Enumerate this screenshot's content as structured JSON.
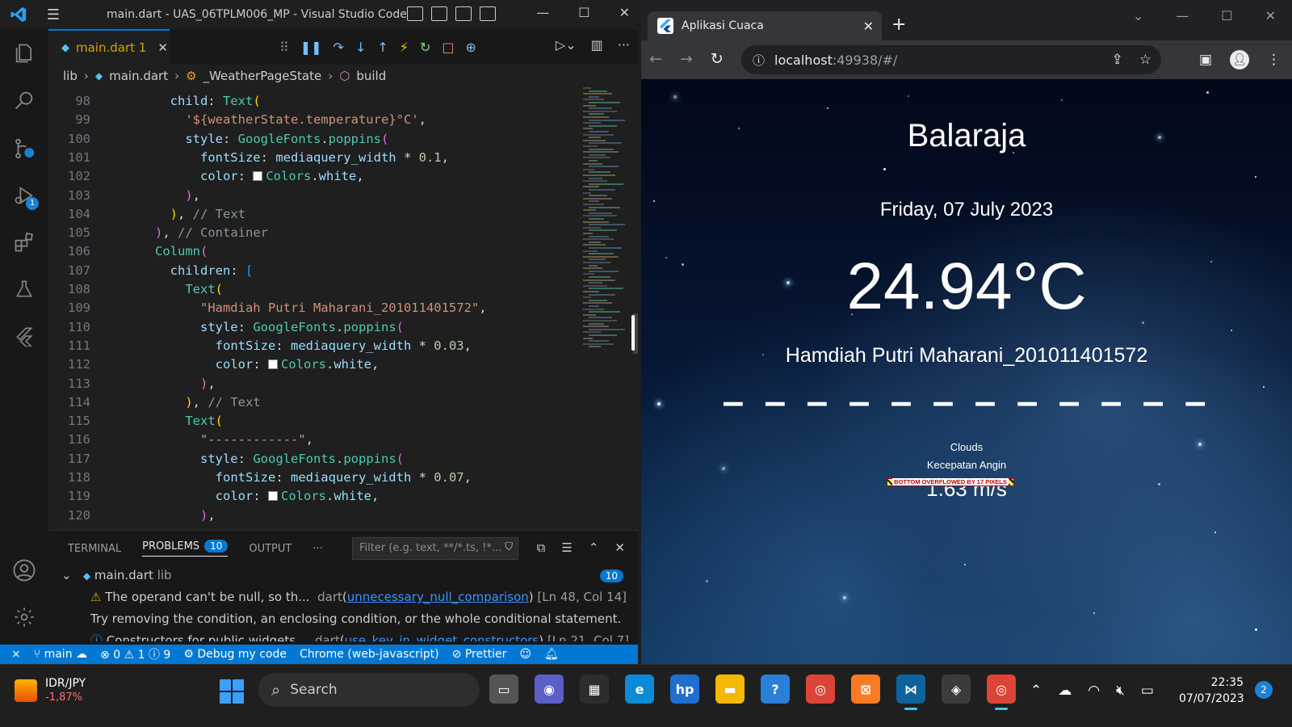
{
  "vscode": {
    "title": "main.dart - UAS_06TPLM006_MP - Visual Studio Code",
    "tab": {
      "label": "main.dart 1",
      "close": "✕"
    },
    "breadcrumb": {
      "folder": "lib",
      "file": "main.dart",
      "class": "_WeatherPageState",
      "method": "build"
    },
    "activity_badges": {
      "run_debug": "1"
    },
    "code_lines": [
      {
        "n": "98",
        "indent": "        ",
        "parts": [
          [
            "prop",
            "child"
          ],
          [
            "plain",
            ": "
          ],
          [
            "func",
            "Text"
          ],
          [
            "br1",
            "("
          ]
        ]
      },
      {
        "n": "99",
        "indent": "          ",
        "parts": [
          [
            "str",
            "'${weatherState.temperature}°C'"
          ],
          [
            "plain",
            ","
          ]
        ]
      },
      {
        "n": "100",
        "indent": "          ",
        "parts": [
          [
            "prop",
            "style"
          ],
          [
            "plain",
            ": "
          ],
          [
            "func",
            "GoogleFonts"
          ],
          [
            "plain",
            "."
          ],
          [
            "func",
            "poppins"
          ],
          [
            "br2",
            "("
          ]
        ]
      },
      {
        "n": "101",
        "indent": "            ",
        "parts": [
          [
            "prop",
            "fontSize"
          ],
          [
            "plain",
            ": "
          ],
          [
            "prop",
            "mediaquery_width"
          ],
          [
            "plain",
            " * "
          ],
          [
            "num",
            "0.1"
          ],
          [
            "plain",
            ","
          ]
        ]
      },
      {
        "n": "102",
        "indent": "            ",
        "parts": [
          [
            "prop",
            "color"
          ],
          [
            "plain",
            ": "
          ],
          [
            "box",
            ""
          ],
          [
            "func",
            "Colors"
          ],
          [
            "plain",
            "."
          ],
          [
            "prop",
            "white"
          ],
          [
            "plain",
            ","
          ]
        ]
      },
      {
        "n": "103",
        "indent": "          ",
        "parts": [
          [
            "br2",
            ")"
          ],
          [
            "plain",
            ","
          ]
        ]
      },
      {
        "n": "104",
        "indent": "        ",
        "parts": [
          [
            "br1",
            ")"
          ],
          [
            "plain",
            ", "
          ],
          [
            "cmt",
            "// Text"
          ]
        ]
      },
      {
        "n": "105",
        "indent": "      ",
        "parts": [
          [
            "br2",
            ")"
          ],
          [
            "plain",
            ", "
          ],
          [
            "cmt",
            "// Container"
          ]
        ]
      },
      {
        "n": "106",
        "indent": "      ",
        "parts": [
          [
            "func",
            "Column"
          ],
          [
            "br2",
            "("
          ]
        ]
      },
      {
        "n": "107",
        "indent": "        ",
        "parts": [
          [
            "prop",
            "children"
          ],
          [
            "plain",
            ": "
          ],
          [
            "br3",
            "["
          ]
        ]
      },
      {
        "n": "108",
        "indent": "          ",
        "parts": [
          [
            "func",
            "Text"
          ],
          [
            "br1",
            "("
          ]
        ]
      },
      {
        "n": "109",
        "indent": "            ",
        "parts": [
          [
            "str",
            "\"Hamdiah Putri Maharani_201011401572\""
          ],
          [
            "plain",
            ","
          ]
        ]
      },
      {
        "n": "110",
        "indent": "            ",
        "parts": [
          [
            "prop",
            "style"
          ],
          [
            "plain",
            ": "
          ],
          [
            "func",
            "GoogleFonts"
          ],
          [
            "plain",
            "."
          ],
          [
            "func",
            "poppins"
          ],
          [
            "br2",
            "("
          ]
        ]
      },
      {
        "n": "111",
        "indent": "              ",
        "parts": [
          [
            "prop",
            "fontSize"
          ],
          [
            "plain",
            ": "
          ],
          [
            "prop",
            "mediaquery_width"
          ],
          [
            "plain",
            " * "
          ],
          [
            "num",
            "0.03"
          ],
          [
            "plain",
            ","
          ]
        ]
      },
      {
        "n": "112",
        "indent": "              ",
        "parts": [
          [
            "prop",
            "color"
          ],
          [
            "plain",
            ": "
          ],
          [
            "box",
            ""
          ],
          [
            "func",
            "Colors"
          ],
          [
            "plain",
            "."
          ],
          [
            "prop",
            "white"
          ],
          [
            "plain",
            ","
          ]
        ]
      },
      {
        "n": "113",
        "indent": "            ",
        "parts": [
          [
            "br2",
            ")"
          ],
          [
            "plain",
            ","
          ]
        ]
      },
      {
        "n": "114",
        "indent": "          ",
        "parts": [
          [
            "br1",
            ")"
          ],
          [
            "plain",
            ", "
          ],
          [
            "cmt",
            "// Text"
          ]
        ]
      },
      {
        "n": "115",
        "indent": "          ",
        "parts": [
          [
            "func",
            "Text"
          ],
          [
            "br1",
            "("
          ]
        ]
      },
      {
        "n": "116",
        "indent": "            ",
        "parts": [
          [
            "str",
            "\"------------\""
          ],
          [
            "plain",
            ","
          ]
        ]
      },
      {
        "n": "117",
        "indent": "            ",
        "parts": [
          [
            "prop",
            "style"
          ],
          [
            "plain",
            ": "
          ],
          [
            "func",
            "GoogleFonts"
          ],
          [
            "plain",
            "."
          ],
          [
            "func",
            "poppins"
          ],
          [
            "br2",
            "("
          ]
        ]
      },
      {
        "n": "118",
        "indent": "              ",
        "parts": [
          [
            "prop",
            "fontSize"
          ],
          [
            "plain",
            ": "
          ],
          [
            "prop",
            "mediaquery_width"
          ],
          [
            "plain",
            " * "
          ],
          [
            "num",
            "0.07"
          ],
          [
            "plain",
            ","
          ]
        ]
      },
      {
        "n": "119",
        "indent": "              ",
        "parts": [
          [
            "prop",
            "color"
          ],
          [
            "plain",
            ": "
          ],
          [
            "box",
            ""
          ],
          [
            "func",
            "Colors"
          ],
          [
            "plain",
            "."
          ],
          [
            "prop",
            "white"
          ],
          [
            "plain",
            ","
          ]
        ]
      },
      {
        "n": "120",
        "indent": "            ",
        "parts": [
          [
            "br2",
            ")"
          ],
          [
            "plain",
            ","
          ]
        ]
      }
    ],
    "panel": {
      "tabs": [
        "TERMINAL",
        "PROBLEMS",
        "OUTPUT"
      ],
      "problems_count": "10",
      "filter_placeholder": "Filter (e.g. text, **/*.ts, !*...",
      "file_row": {
        "file": "main.dart",
        "folder": "lib",
        "count": "10"
      },
      "problem1": {
        "message": "The operand can't be null, so th...",
        "source": "dart",
        "rule": "unnecessary_null_comparison",
        "loc": "[Ln 48, Col 14]"
      },
      "problem1_hint": "Try removing the condition, an enclosing condition, or the whole conditional statement.",
      "problem2": {
        "message": "Constructors for public widgets...",
        "source": "dart",
        "rule": "use_key_in_widget_constructors",
        "loc": "[Ln 21, Col 7]"
      }
    },
    "status": {
      "branch": "main",
      "errors": "0",
      "warnings": "1",
      "infos": "9",
      "debug": "Debug my code",
      "target": "Chrome (web-javascript)",
      "prettier": "Prettier"
    }
  },
  "chrome": {
    "tab_title": "Aplikasi Cuaca",
    "url_host": "localhost",
    "url_rest": ":49938/#/"
  },
  "weather": {
    "city": "Balaraja",
    "date": "Friday, 07 July 2023",
    "temperature": "24.94°C",
    "name": "Hamdiah Putri Maharani_201011401572",
    "dashes": "– – – – – – – – – – – –",
    "description": "Clouds",
    "wind_label": "Kecepatan Angin",
    "wind_speed": "1.63 m/s",
    "overflow_message": "BOTTOM OVERFLOWED BY 17 PIXELS"
  },
  "taskbar": {
    "stock_symbol": "IDR/JPY",
    "stock_change": "-1,87%",
    "search_label": "Search",
    "time": "22:35",
    "date": "07/07/2023",
    "notifications": "2"
  },
  "colors": {
    "vscode_accent": "#0078d4",
    "tab_modified": "#cca700",
    "link": "#3794ff"
  }
}
